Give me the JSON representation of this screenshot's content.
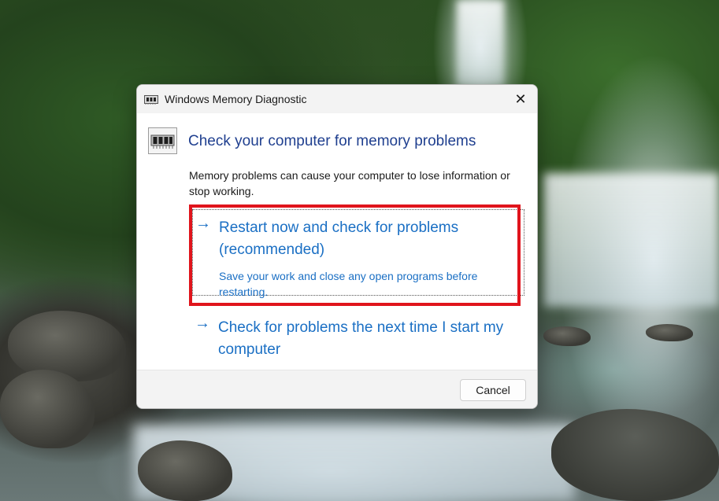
{
  "window": {
    "title": "Windows Memory Diagnostic",
    "close_glyph": "✕"
  },
  "main": {
    "heading": "Check your computer for memory problems",
    "description": "Memory problems can cause your computer to lose information or stop working."
  },
  "options": [
    {
      "arrow": "→",
      "title": "Restart now and check for problems (recommended)",
      "subtitle": "Save your work and close any open programs before restarting."
    },
    {
      "arrow": "→",
      "title": "Check for problems the next time I start my computer"
    }
  ],
  "footer": {
    "cancel_label": "Cancel"
  },
  "colors": {
    "link": "#1a6fc4",
    "heading": "#1f3f8f",
    "highlight": "#e0141c"
  },
  "icons": {
    "title": "memory-chip-icon",
    "content": "memory-chip-icon"
  }
}
